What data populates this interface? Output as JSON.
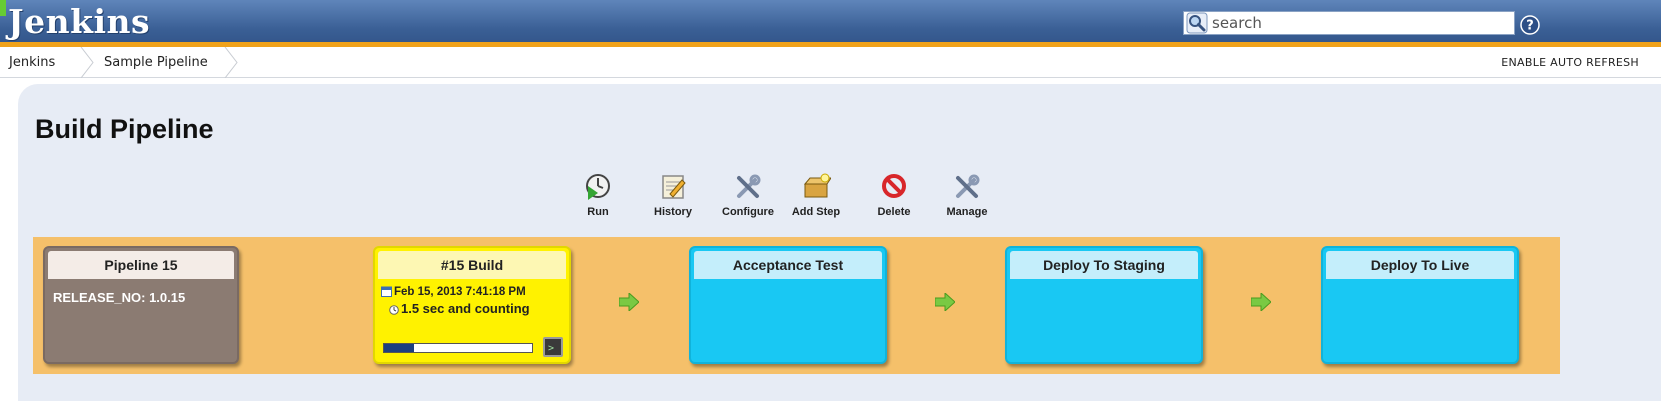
{
  "header": {
    "logo": "Jenkins",
    "search_placeholder": "search"
  },
  "breadcrumb": {
    "items": [
      "Jenkins",
      "Sample Pipeline"
    ],
    "auto_refresh": "ENABLE AUTO REFRESH"
  },
  "page": {
    "title": "Build Pipeline"
  },
  "toolbar": {
    "items": [
      {
        "label": "Run",
        "icon": "run-icon"
      },
      {
        "label": "History",
        "icon": "history-icon"
      },
      {
        "label": "Configure",
        "icon": "configure-icon"
      },
      {
        "label": "Add Step",
        "icon": "add-step-icon"
      },
      {
        "label": "Delete",
        "icon": "delete-icon"
      },
      {
        "label": "Manage",
        "icon": "manage-icon"
      }
    ]
  },
  "pipeline": {
    "revision": {
      "title": "Pipeline 15",
      "param": "RELEASE_NO: 1.0.15"
    },
    "build": {
      "title": "#15 Build",
      "date": "Feb 15, 2013 7:41:18 PM",
      "duration": "1.5 sec and counting",
      "progress_percent": 20
    },
    "stages": [
      {
        "title": "Acceptance Test"
      },
      {
        "title": "Deploy To Staging"
      },
      {
        "title": "Deploy To Live"
      }
    ],
    "colors": {
      "band": "#f5c06a",
      "revision": "#8b7b72",
      "building": "#fff200",
      "pending": "#19c8f3",
      "arrow": "#7ac943"
    }
  }
}
